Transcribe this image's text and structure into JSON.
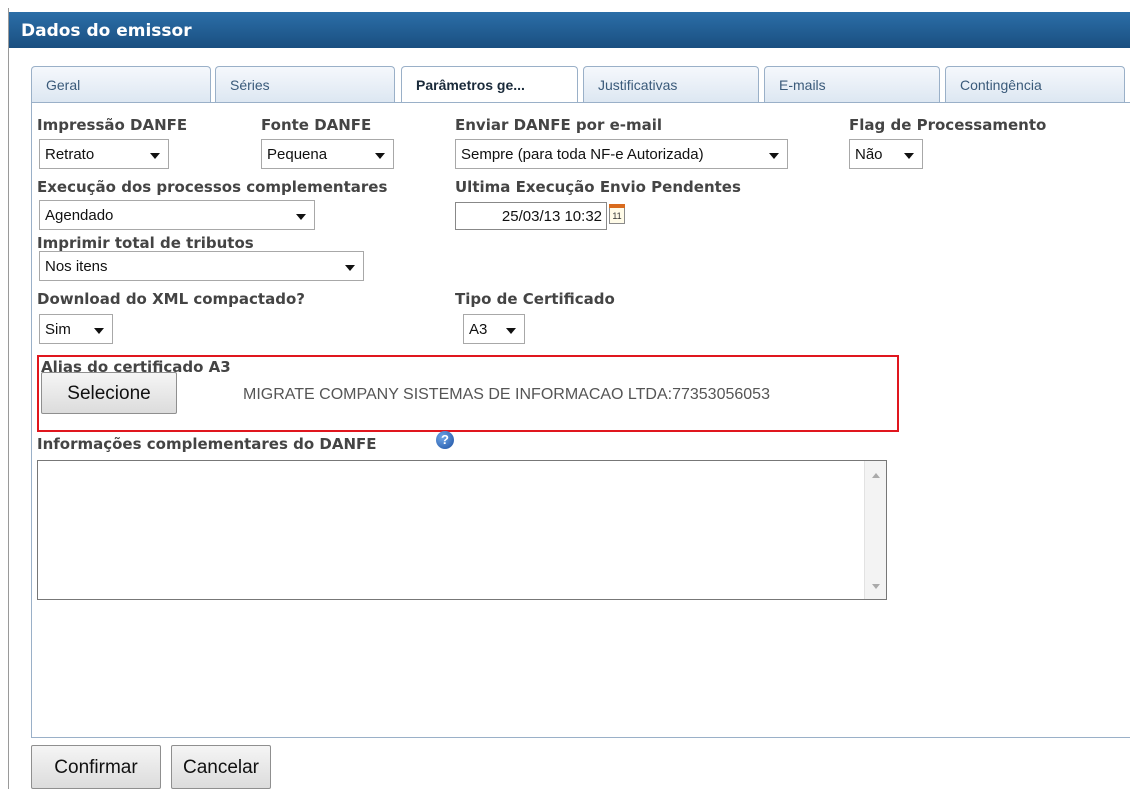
{
  "window": {
    "title": "Dados do emissor"
  },
  "tabs": [
    {
      "label": "Geral"
    },
    {
      "label": "Séries"
    },
    {
      "label": "Parâmetros ge..."
    },
    {
      "label": "Justificativas"
    },
    {
      "label": "E-mails"
    },
    {
      "label": "Contingência"
    }
  ],
  "form": {
    "impressao_danfe": {
      "label": "Impressão DANFE",
      "value": "Retrato"
    },
    "fonte_danfe": {
      "label": "Fonte DANFE",
      "value": "Pequena"
    },
    "enviar_danfe": {
      "label": "Enviar DANFE por e-mail",
      "value": "Sempre (para toda NF-e Autorizada)"
    },
    "flag_processamento": {
      "label": "Flag de Processamento",
      "value": "Não"
    },
    "execucao_processos": {
      "label": "Execução dos processos complementares",
      "value": "Agendado"
    },
    "ultima_execucao": {
      "label": "Ultima Execução Envio Pendentes",
      "value": "25/03/13 10:32",
      "calendar_day": "11"
    },
    "imprimir_total": {
      "label": "Imprimir total de tributos",
      "value": "Nos itens"
    },
    "download_xml": {
      "label": "Download do XML compactado?",
      "value": "Sim"
    },
    "tipo_certificado": {
      "label": "Tipo de Certificado",
      "value": "A3"
    },
    "alias_certificado": {
      "label": "Alias do certificado A3",
      "button_label": "Selecione",
      "value": "MIGRATE COMPANY SISTEMAS DE INFORMACAO LTDA:77353056053"
    },
    "informacoes": {
      "label": "Informações complementares do DANFE",
      "value": ""
    }
  },
  "icons": {
    "help": "?",
    "highlight_color": "#e0161e",
    "title_color": "#1a4f80"
  },
  "footer": {
    "confirm_label": "Confirmar",
    "cancel_label": "Cancelar"
  }
}
